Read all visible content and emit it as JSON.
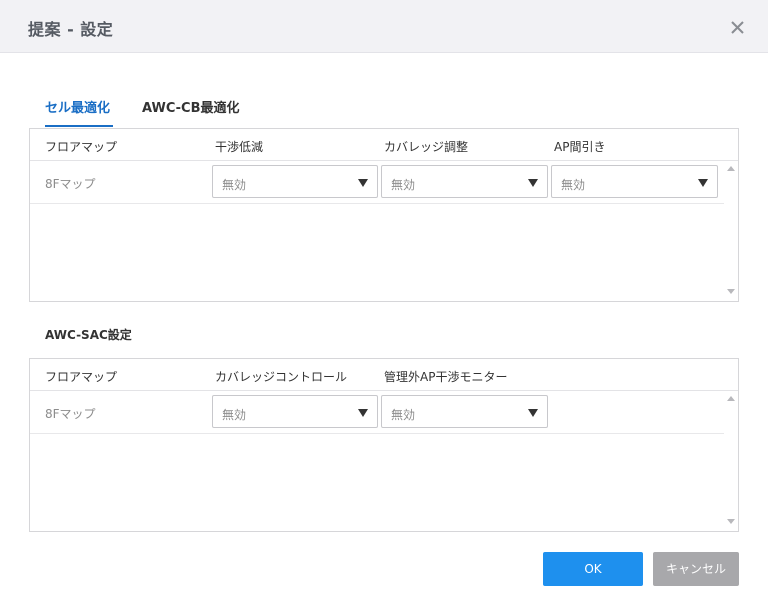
{
  "dialog": {
    "title": "提案 - 設定"
  },
  "tabs": [
    {
      "label": "セル最適化",
      "active": true
    },
    {
      "label": "AWC-CB最適化",
      "active": false
    }
  ],
  "cell_table": {
    "headers": [
      "フロアマップ",
      "干渉低減",
      "カバレッジ調整",
      "AP間引き"
    ],
    "rows": [
      {
        "floor_map": "8Fマップ",
        "interference_reduction": "無効",
        "coverage_adjustment": "無効",
        "ap_thinning": "無効"
      }
    ]
  },
  "sac_section": {
    "title": "AWC-SAC設定",
    "headers": [
      "フロアマップ",
      "カバレッジコントロール",
      "管理外AP干渉モニター"
    ],
    "rows": [
      {
        "floor_map": "8Fマップ",
        "coverage_control": "無効",
        "unmanaged_ap_monitor": "無効"
      }
    ]
  },
  "footer": {
    "ok_label": "OK",
    "cancel_label": "キャンセル"
  },
  "colors": {
    "accent": "#1a6ec5",
    "ok_button": "#1e90ee",
    "cancel_button": "#a8a8ab",
    "header_bg": "#f2f2f5"
  },
  "icons": {
    "close": "close-icon",
    "dropdown": "chevron-down-icon",
    "scroll_up": "scroll-up-arrow-icon",
    "scroll_down": "scroll-down-arrow-icon"
  }
}
